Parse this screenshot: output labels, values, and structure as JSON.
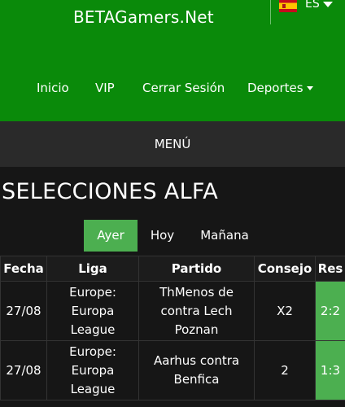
{
  "header": {
    "brand": "BETAGamers.Net",
    "language": {
      "code": "ES",
      "flag_icon": "spain-flag-icon"
    },
    "nav": [
      {
        "label": "Inicio"
      },
      {
        "label": "VIP"
      },
      {
        "label": "Cerrar Sesión"
      },
      {
        "label": "Deportes"
      }
    ]
  },
  "menu": {
    "label": "MENÚ"
  },
  "page": {
    "title": "SELECCIONES ALFA"
  },
  "tabs": [
    {
      "label": "Ayer",
      "active": true
    },
    {
      "label": "Hoy",
      "active": false
    },
    {
      "label": "Mañana",
      "active": false
    }
  ],
  "table": {
    "headers": [
      "Fecha",
      "Liga",
      "Partido",
      "Consejo",
      "Res"
    ],
    "rows": [
      {
        "fecha": "27/08",
        "liga": "Europe: Europa League",
        "partido": "ThMenos de contra Lech Poznan",
        "consejo": "X2",
        "res": "2:2"
      },
      {
        "fecha": "27/08",
        "liga": "Europe: Europa League",
        "partido": "Aarhus contra Benfica",
        "consejo": "2",
        "res": "1:3"
      }
    ]
  },
  "colors": {
    "header_bg": "#0a8a0a",
    "menu_bg": "#2a2a2a",
    "page_bg": "#161616",
    "accent_green": "#4caf50"
  }
}
